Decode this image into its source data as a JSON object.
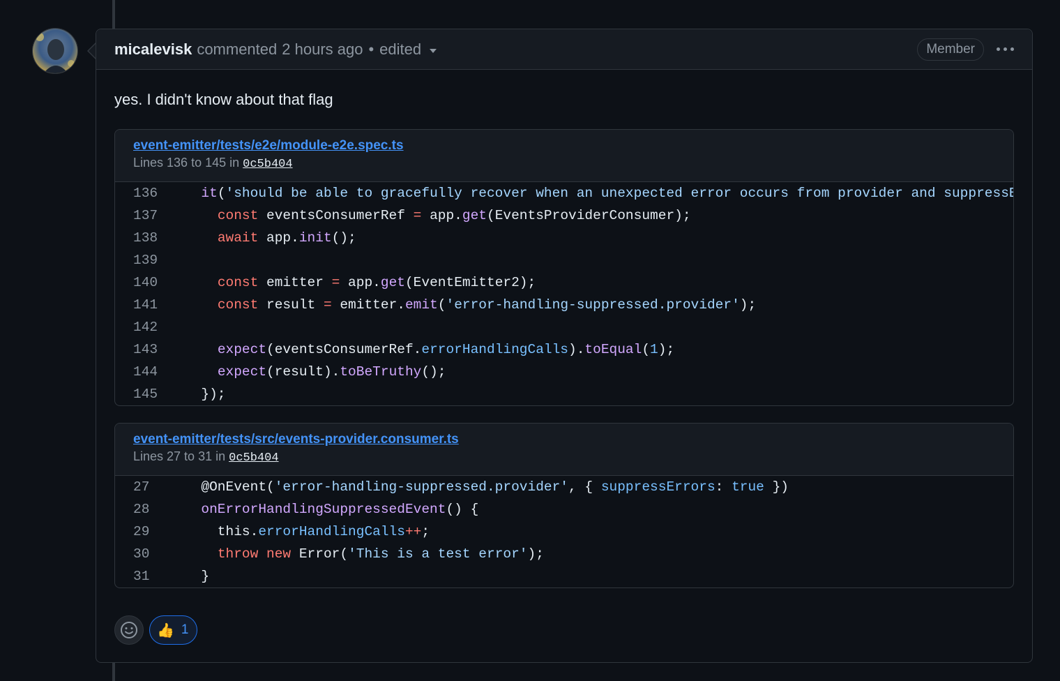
{
  "comment": {
    "author": "micalevisk",
    "action": "commented",
    "time": "2 hours ago",
    "separator": "•",
    "edited": "edited",
    "badge": "Member",
    "body": "yes. I didn't know about that flag"
  },
  "snippets": [
    {
      "file": "event-emitter/tests/e2e/module-e2e.spec.ts",
      "lines_prefix": "Lines 136 to 145 in",
      "sha": "0c5b404",
      "lines": [
        {
          "n": "136",
          "tokens": [
            [
              "",
              "  "
            ],
            [
              "fn",
              "it"
            ],
            [
              "",
              "("
            ],
            [
              "str",
              "'should be able to gracefully recover when an unexpected error occurs from provider and suppressEr"
            ]
          ]
        },
        {
          "n": "137",
          "tokens": [
            [
              "",
              "    "
            ],
            [
              "kw",
              "const"
            ],
            [
              "",
              " eventsConsumerRef "
            ],
            [
              "kw",
              "="
            ],
            [
              "",
              " app."
            ],
            [
              "fn",
              "get"
            ],
            [
              "",
              "(EventsProviderConsumer);"
            ]
          ]
        },
        {
          "n": "138",
          "tokens": [
            [
              "",
              "    "
            ],
            [
              "kw",
              "await"
            ],
            [
              "",
              " app."
            ],
            [
              "fn",
              "init"
            ],
            [
              "",
              "();"
            ]
          ]
        },
        {
          "n": "139",
          "tokens": []
        },
        {
          "n": "140",
          "tokens": [
            [
              "",
              "    "
            ],
            [
              "kw",
              "const"
            ],
            [
              "",
              " emitter "
            ],
            [
              "kw",
              "="
            ],
            [
              "",
              " app."
            ],
            [
              "fn",
              "get"
            ],
            [
              "",
              "(EventEmitter2);"
            ]
          ]
        },
        {
          "n": "141",
          "tokens": [
            [
              "",
              "    "
            ],
            [
              "kw",
              "const"
            ],
            [
              "",
              " result "
            ],
            [
              "kw",
              "="
            ],
            [
              "",
              " emitter."
            ],
            [
              "fn",
              "emit"
            ],
            [
              "",
              "("
            ],
            [
              "str",
              "'error-handling-suppressed.provider'"
            ],
            [
              "",
              ");"
            ]
          ]
        },
        {
          "n": "142",
          "tokens": []
        },
        {
          "n": "143",
          "tokens": [
            [
              "",
              "    "
            ],
            [
              "fn",
              "expect"
            ],
            [
              "",
              "(eventsConsumerRef."
            ],
            [
              "prop",
              "errorHandlingCalls"
            ],
            [
              "",
              ")."
            ],
            [
              "fn",
              "toEqual"
            ],
            [
              "",
              "("
            ],
            [
              "num",
              "1"
            ],
            [
              "",
              ");"
            ]
          ]
        },
        {
          "n": "144",
          "tokens": [
            [
              "",
              "    "
            ],
            [
              "fn",
              "expect"
            ],
            [
              "",
              "(result)."
            ],
            [
              "fn",
              "toBeTruthy"
            ],
            [
              "",
              "();"
            ]
          ]
        },
        {
          "n": "145",
          "tokens": [
            [
              "",
              "  });"
            ]
          ]
        }
      ]
    },
    {
      "file": "event-emitter/tests/src/events-provider.consumer.ts",
      "lines_prefix": "Lines 27 to 31 in",
      "sha": "0c5b404",
      "lines": [
        {
          "n": "27",
          "tokens": [
            [
              "",
              "  @OnEvent("
            ],
            [
              "str",
              "'error-handling-suppressed.provider'"
            ],
            [
              "",
              ", { "
            ],
            [
              "prop",
              "suppressErrors"
            ],
            [
              "",
              ": "
            ],
            [
              "num",
              "true"
            ],
            [
              "",
              " })"
            ]
          ]
        },
        {
          "n": "28",
          "tokens": [
            [
              "",
              "  "
            ],
            [
              "fn",
              "onErrorHandlingSuppressedEvent"
            ],
            [
              "",
              "() {"
            ]
          ]
        },
        {
          "n": "29",
          "tokens": [
            [
              "",
              "    this."
            ],
            [
              "prop",
              "errorHandlingCalls"
            ],
            [
              "kw",
              "++"
            ],
            [
              "",
              ";"
            ]
          ]
        },
        {
          "n": "30",
          "tokens": [
            [
              "",
              "    "
            ],
            [
              "kw",
              "throw"
            ],
            [
              "",
              " "
            ],
            [
              "kw",
              "new"
            ],
            [
              "",
              " Error("
            ],
            [
              "str",
              "'This is a test error'"
            ],
            [
              "",
              ");"
            ]
          ]
        },
        {
          "n": "31",
          "tokens": [
            [
              "",
              "  }"
            ]
          ]
        }
      ]
    }
  ],
  "reactions": {
    "thumbs_up_emoji": "👍",
    "thumbs_up_count": "1"
  },
  "icons": {
    "avatar": "avatar",
    "caret": "chevron-down-icon",
    "more": "kebab-horizontal-icon",
    "emoji": "smiley-icon"
  }
}
